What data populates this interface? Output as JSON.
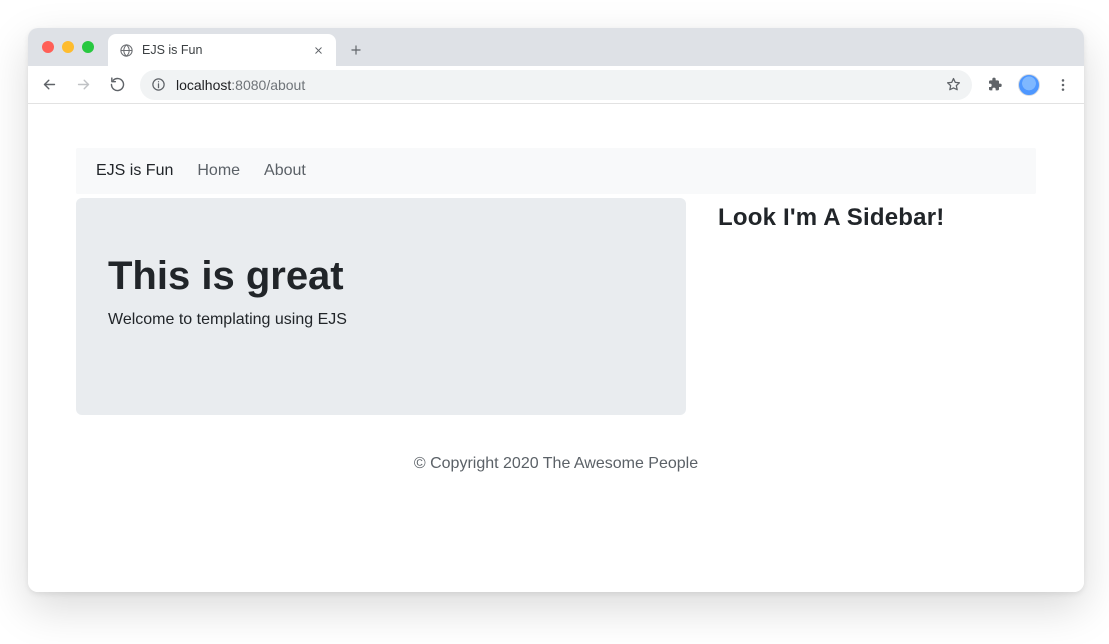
{
  "browser": {
    "tab": {
      "title": "EJS is Fun"
    },
    "url": {
      "host": "localhost",
      "port": ":8080",
      "path": "/about"
    }
  },
  "page": {
    "nav": {
      "brand": "EJS is Fun",
      "links": [
        "Home",
        "About"
      ]
    },
    "jumbo": {
      "heading": "This is great",
      "lead": "Welcome to templating using EJS"
    },
    "sidebar": {
      "title": "Look I'm A Sidebar!"
    },
    "footer": "© Copyright 2020 The Awesome People"
  }
}
